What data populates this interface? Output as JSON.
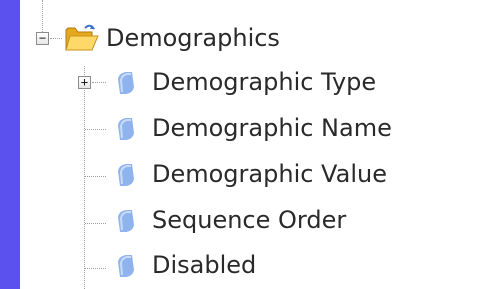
{
  "tree": {
    "root": {
      "label": "Demographics",
      "icon": "folder-open-icon",
      "expanded": true
    },
    "children": [
      {
        "label": "Demographic Type",
        "icon": "field-icon",
        "expandable": true
      },
      {
        "label": "Demographic Name",
        "icon": "field-icon",
        "expandable": false
      },
      {
        "label": "Demographic Value",
        "icon": "field-icon",
        "expandable": false
      },
      {
        "label": "Sequence Order",
        "icon": "field-icon",
        "expandable": false
      },
      {
        "label": "Disabled",
        "icon": "field-icon",
        "expandable": false
      }
    ]
  },
  "colors": {
    "background": "#5b51ee",
    "panel": "#ffffff",
    "field_icon": "#8fb3ec",
    "folder": "#f3c34a"
  }
}
